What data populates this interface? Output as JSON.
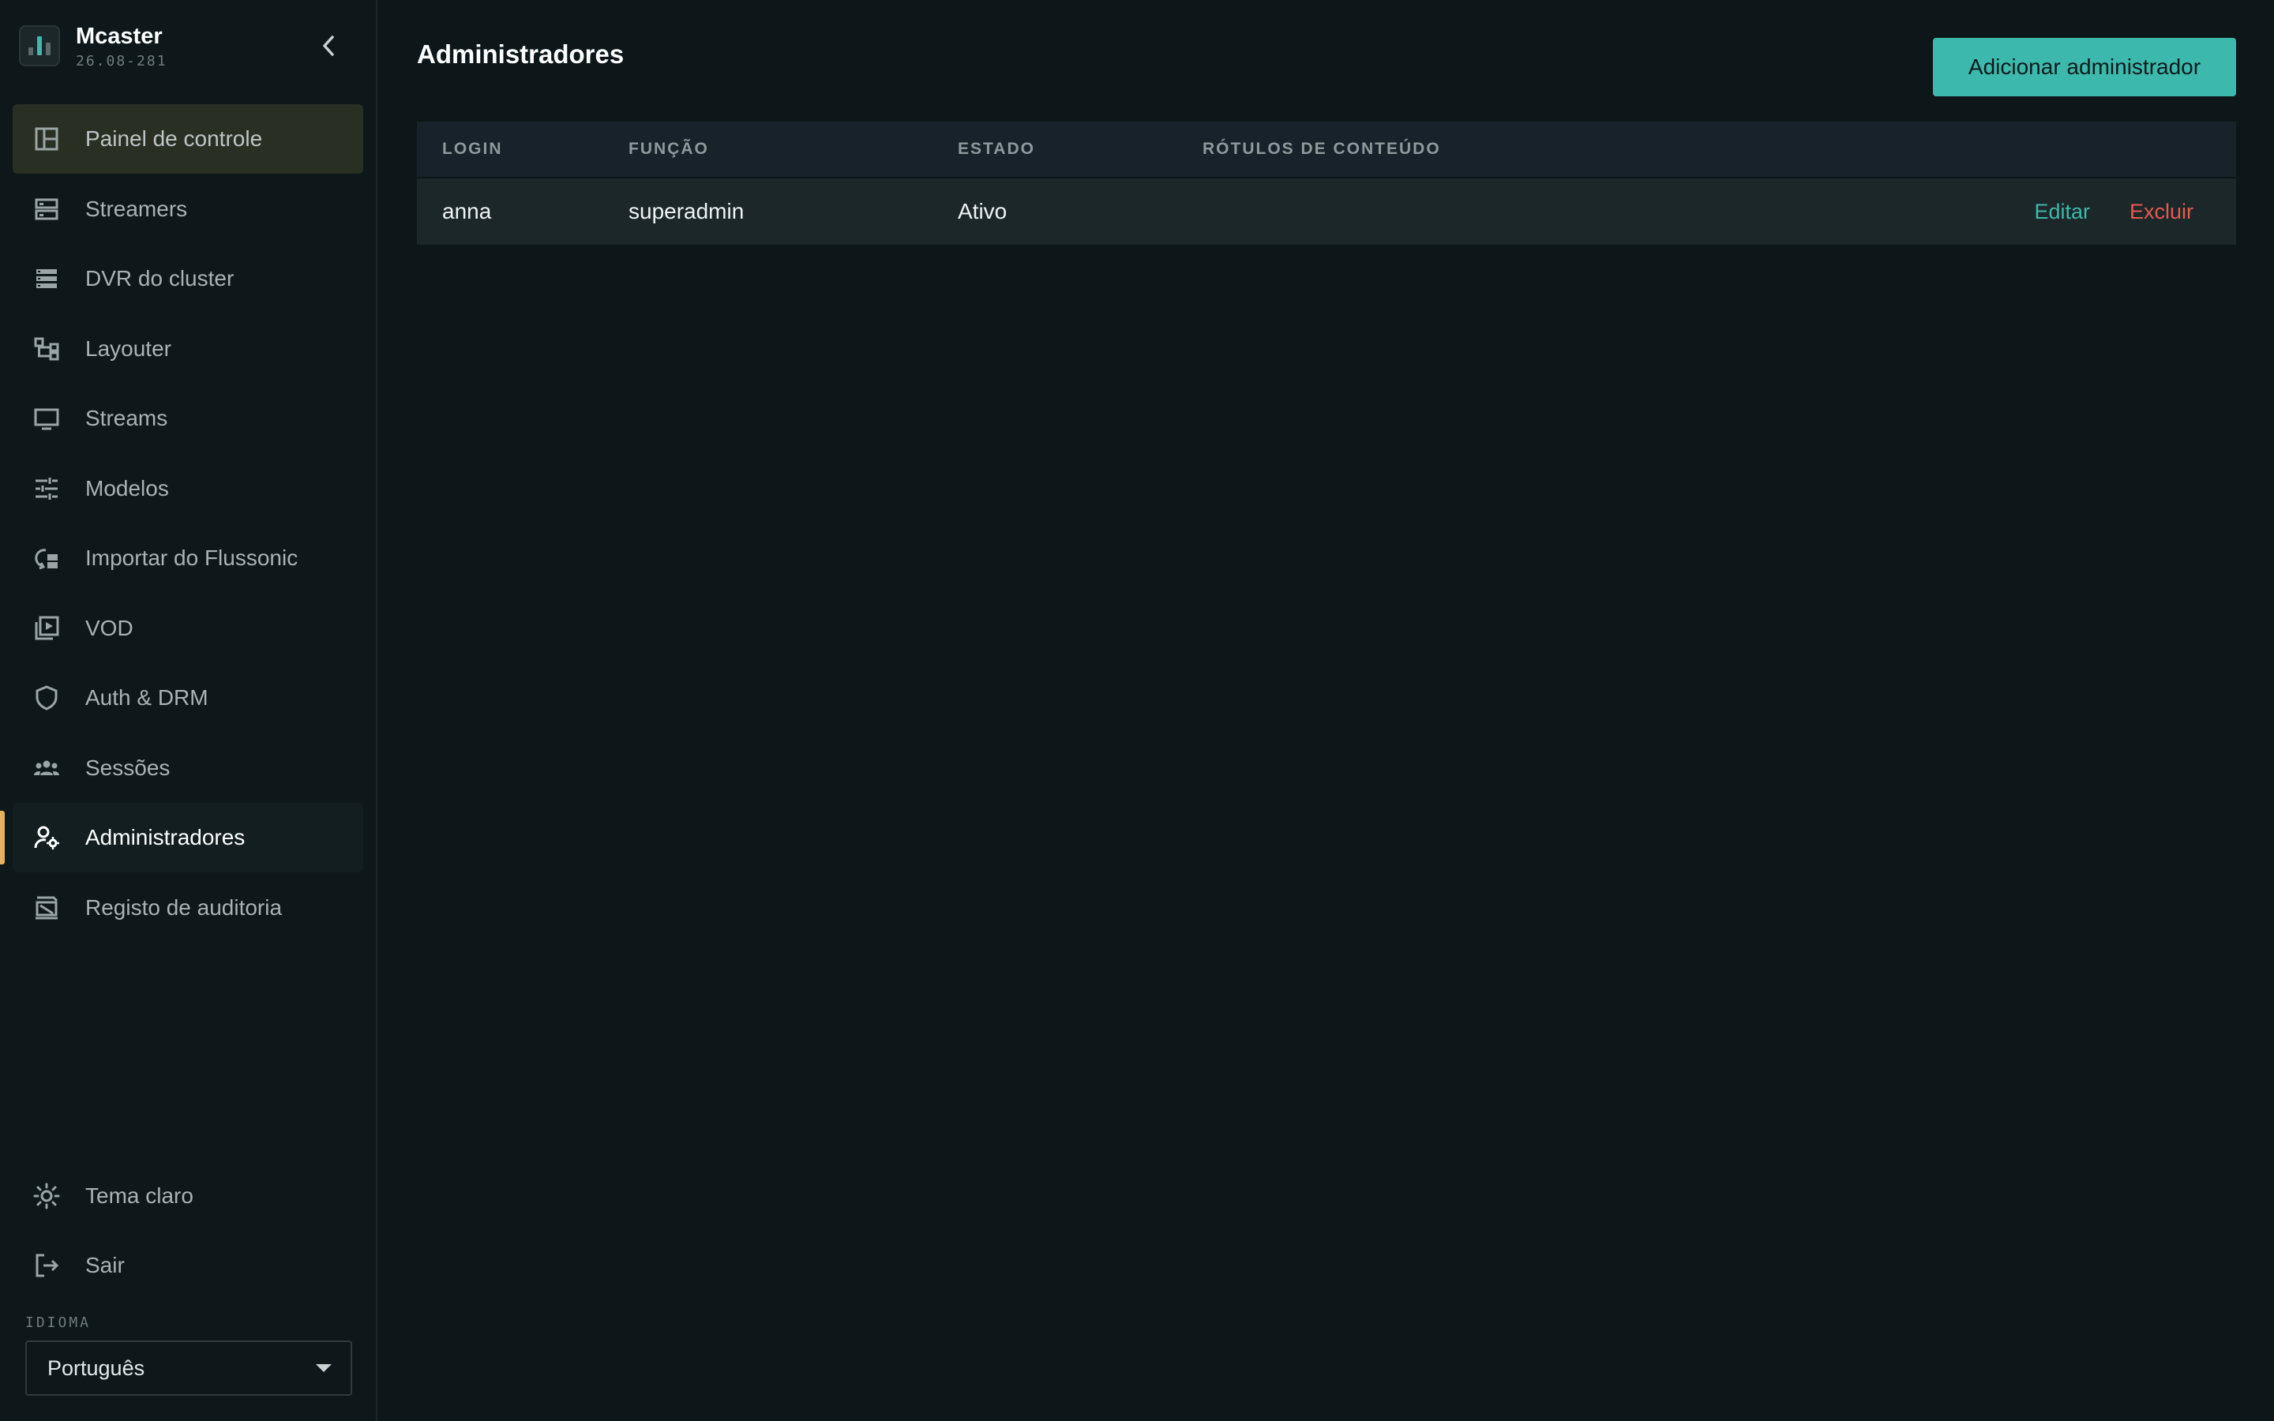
{
  "app": {
    "name": "Mcaster",
    "version": "26.08-281"
  },
  "sidebar": {
    "items": [
      {
        "label": "Painel de controle",
        "icon": "dashboard-icon"
      },
      {
        "label": "Streamers",
        "icon": "server-icon"
      },
      {
        "label": "DVR do cluster",
        "icon": "storage-icon"
      },
      {
        "label": "Layouter",
        "icon": "layout-tree-icon"
      },
      {
        "label": "Streams",
        "icon": "monitor-icon"
      },
      {
        "label": "Modelos",
        "icon": "sliders-icon"
      },
      {
        "label": "Importar do Flussonic",
        "icon": "import-icon"
      },
      {
        "label": "VOD",
        "icon": "video-library-icon"
      },
      {
        "label": "Auth & DRM",
        "icon": "shield-icon"
      },
      {
        "label": "Sessões",
        "icon": "group-icon"
      },
      {
        "label": "Administradores",
        "icon": "user-gear-icon"
      },
      {
        "label": "Registo de auditoria",
        "icon": "audit-icon"
      }
    ],
    "bottom": {
      "theme_label": "Tema claro",
      "logout_label": "Sair",
      "language_label": "IDIOMA",
      "language_value": "Português"
    }
  },
  "main": {
    "title": "Administradores",
    "add_button": "Adicionar administrador",
    "table": {
      "headers": [
        "LOGIN",
        "FUNÇÃO",
        "ESTADO",
        "RÓTULOS DE CONTEÚDO"
      ],
      "rows": [
        {
          "login": "anna",
          "role": "superadmin",
          "status": "Ativo",
          "labels": "",
          "edit": "Editar",
          "delete": "Excluir"
        }
      ]
    }
  },
  "colors": {
    "accent": "#3db8ac",
    "danger": "#e9594f",
    "active_marker": "#e6b35c",
    "background": "#0d1719"
  }
}
